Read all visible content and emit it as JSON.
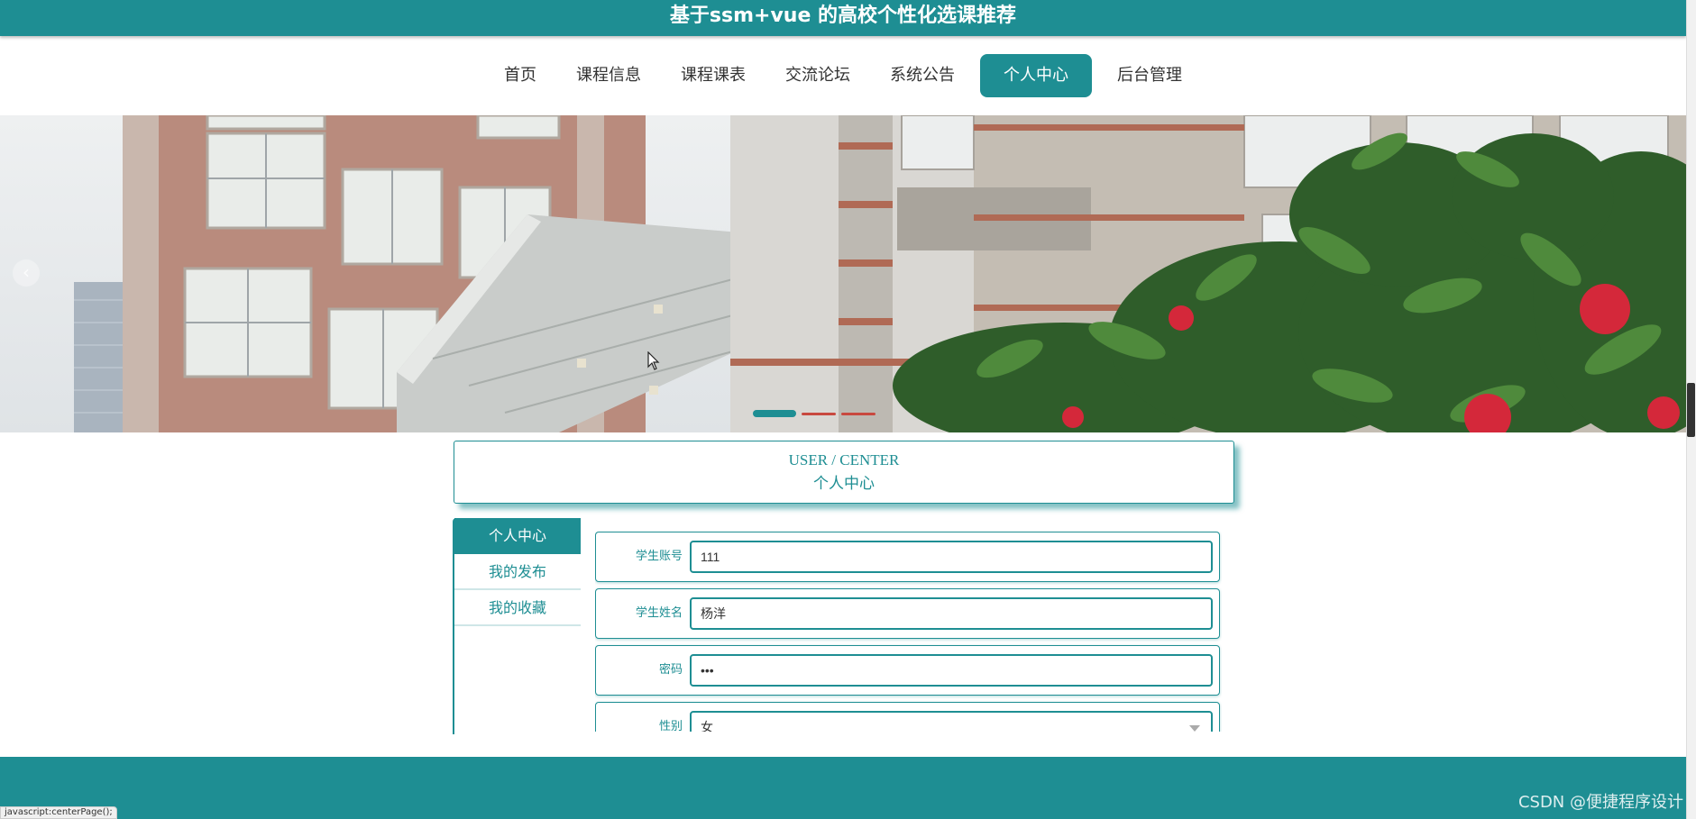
{
  "header": {
    "title": "基于ssm+vue 的高校个性化选课推荐"
  },
  "nav": {
    "items": [
      {
        "label": "首页"
      },
      {
        "label": "课程信息"
      },
      {
        "label": "课程课表"
      },
      {
        "label": "交流论坛"
      },
      {
        "label": "系统公告"
      },
      {
        "label": "个人中心",
        "active": true
      },
      {
        "label": "后台管理"
      }
    ]
  },
  "banner": {
    "prev_icon": "‹",
    "indicator_count": 3,
    "active_index": 0
  },
  "center": {
    "title_en": "USER / CENTER",
    "title_zh": "个人中心"
  },
  "side_menu": {
    "items": [
      {
        "label": "个人中心",
        "active": true
      },
      {
        "label": "我的发布"
      },
      {
        "label": "我的收藏"
      }
    ]
  },
  "form": {
    "fields": [
      {
        "label": "学生账号",
        "value": "111"
      },
      {
        "label": "学生姓名",
        "value": "杨洋"
      },
      {
        "label": "密码",
        "value": "•••"
      },
      {
        "label": "性别",
        "value": "女"
      }
    ]
  },
  "watermark": "CSDN @便捷程序设计",
  "statusbar": "javascript:centerPage();",
  "colors": {
    "primary": "#1e8e93",
    "page_bg": "#ffffff",
    "banner_flower": "#d4283a"
  },
  "icons": [
    "chevron-left-icon",
    "select-caret-icon",
    "mouse-cursor-icon"
  ]
}
